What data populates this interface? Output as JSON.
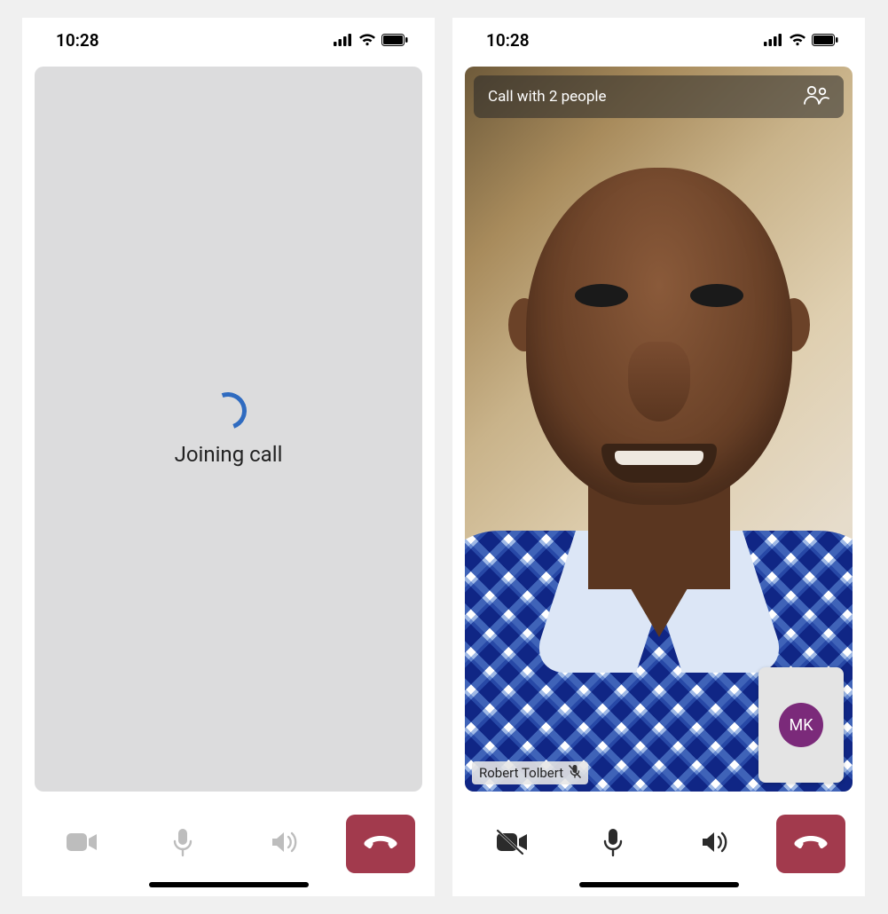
{
  "left": {
    "status": {
      "time": "10:28"
    },
    "loading_text": "Joining call",
    "controls": {
      "camera_enabled": false,
      "mic_enabled": true,
      "speaker_enabled": false
    }
  },
  "right": {
    "status": {
      "time": "10:28"
    },
    "header": {
      "title": "Call with 2 people"
    },
    "participant": {
      "name": "Robert Tolbert",
      "mic_muted": true
    },
    "pip": {
      "initials": "MK",
      "avatar_color": "#7b2a7a"
    },
    "controls": {
      "camera_enabled": false,
      "mic_enabled": true,
      "speaker_enabled": true
    }
  },
  "colors": {
    "hangup": "#a23a4d",
    "spinner": "#2f6bc0"
  }
}
